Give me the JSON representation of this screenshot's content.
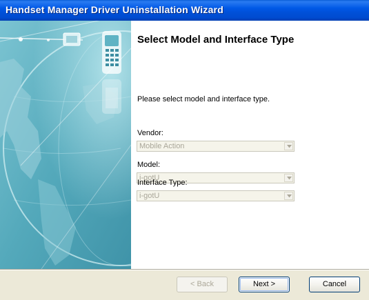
{
  "window": {
    "title": "Handset Manager Driver Uninstallation Wizard"
  },
  "page": {
    "heading": "Select Model and Interface Type",
    "intro": "Please select model and interface type."
  },
  "fields": {
    "vendor": {
      "label": "Vendor:",
      "value": "Mobile Action"
    },
    "model": {
      "label": "Model:",
      "value": "i-gotU"
    },
    "interface": {
      "label": "Interface Type:",
      "value": "i-gotU"
    }
  },
  "buttons": {
    "back": "< Back",
    "next": "Next >",
    "cancel": "Cancel"
  },
  "colors": {
    "titlebar": "#0058e6",
    "dialog_bg": "#ece9d8",
    "side_art": "#5fb3c4"
  },
  "icons": [
    "globe-art",
    "handset-icon",
    "dropdown-arrow-icon"
  ]
}
